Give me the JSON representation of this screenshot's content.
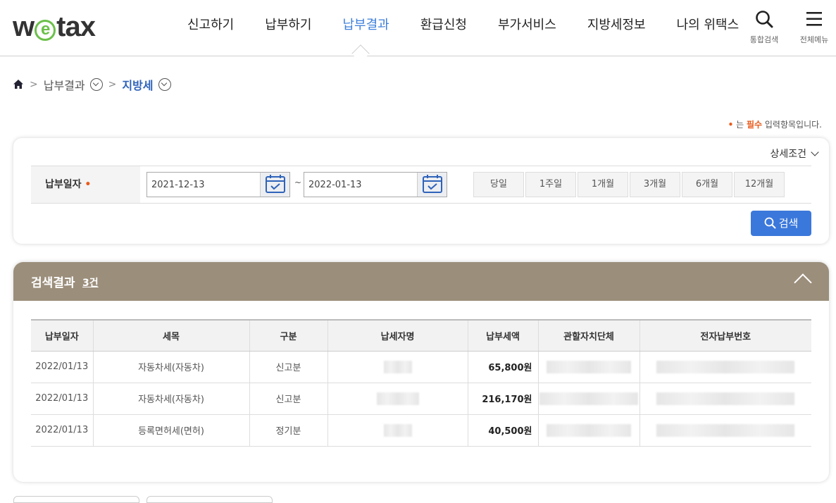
{
  "header": {
    "logo_pre": "w",
    "logo_e": "e",
    "logo_post": "tax",
    "nav": [
      "신고하기",
      "납부하기",
      "납부결과",
      "환급신청",
      "부가서비스",
      "지방세정보",
      "나의 위택스"
    ],
    "active_nav": "납부결과",
    "search_label": "통합검색",
    "menu_label": "전체메뉴"
  },
  "breadcrumb": {
    "level1": "납부결과",
    "level2": "지방세"
  },
  "required_note": {
    "dot": "•",
    "pre": "는",
    "req": "필수",
    "post": "입력항목입니다."
  },
  "search": {
    "detail_label": "상세조건",
    "date_label": "납부일자",
    "required_dot": "•",
    "start_date": "2021-12-13",
    "end_date": "2022-01-13",
    "tilde": "~",
    "periods": [
      "당일",
      "1주일",
      "1개월",
      "3개월",
      "6개월",
      "12개월"
    ],
    "search_button": "검색"
  },
  "result": {
    "title": "검색결과",
    "count": "3건",
    "columns": [
      "납부일자",
      "세목",
      "구분",
      "납세자명",
      "납부세액",
      "관할자치단체",
      "전자납부번호"
    ],
    "rows": [
      {
        "date": "2022/01/13",
        "tax": "자동차세(자동차)",
        "type": "신고분",
        "amount": "65,800원"
      },
      {
        "date": "2022/01/13",
        "tax": "자동차세(자동차)",
        "type": "신고분",
        "amount": "216,170원"
      },
      {
        "date": "2022/01/13",
        "tax": "등록면허세(면허)",
        "type": "정기분",
        "amount": "40,500원"
      }
    ]
  },
  "colors": {
    "accent": "#3b78db",
    "result_header": "#9b8e7b",
    "required": "#e85a1a",
    "logo_green": "#6cc04a"
  }
}
